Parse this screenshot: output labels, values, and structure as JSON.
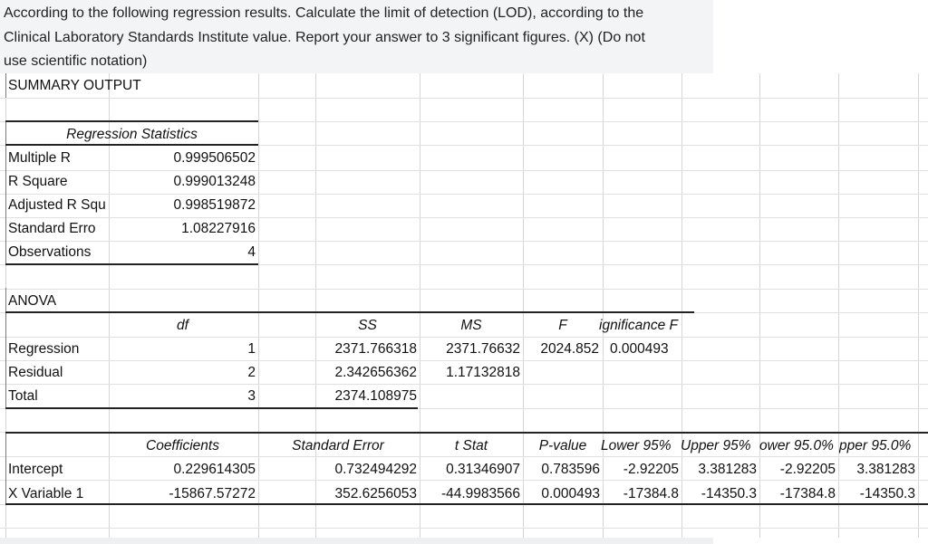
{
  "question": {
    "line1": "According to the following regression results.  Calculate the limit of detection (LOD), according to the",
    "line2": "Clinical Laboratory Standards Institute value.  Report your answer to 3 significant figures. (X) (Do not",
    "line3": "use scientific notation)"
  },
  "summary_title": "SUMMARY OUTPUT",
  "regression_statistics": {
    "header": "Regression Statistics",
    "rows": [
      {
        "label": "Multiple R",
        "value": "0.999506502"
      },
      {
        "label": "R Square",
        "value": "0.999013248"
      },
      {
        "label": "Adjusted R Squ",
        "value": "0.998519872"
      },
      {
        "label": "Standard Erro",
        "value": "1.08227916"
      },
      {
        "label": "Observations",
        "value": "4"
      }
    ]
  },
  "anova": {
    "title": "ANOVA",
    "headers": {
      "df": "df",
      "ss": "SS",
      "ms": "MS",
      "f": "F",
      "sig": "ignificance F"
    },
    "rows": [
      {
        "label": "Regression",
        "df": "1",
        "ss": "2371.766318",
        "ms": "2371.76632",
        "f": "2024.852",
        "sig": "0.000493"
      },
      {
        "label": "Residual",
        "df": "2",
        "ss": "2.342656362",
        "ms": "1.17132818",
        "f": "",
        "sig": ""
      },
      {
        "label": "Total",
        "df": "3",
        "ss": "2374.108975",
        "ms": "",
        "f": "",
        "sig": ""
      }
    ]
  },
  "coefficients": {
    "headers": {
      "coef": "Coefficients",
      "se": "Standard Error",
      "t": "t Stat",
      "p": "P-value",
      "lower95": "Lower 95%",
      "upper95": "Upper 95%",
      "lower950": "ower 95.0%",
      "upper950": "pper 95.0%"
    },
    "rows": [
      {
        "label": "Intercept",
        "coef": "0.229614305",
        "se": "0.732494292",
        "t": "0.31346907",
        "p": "0.783596",
        "lower95": "-2.92205",
        "upper95": "3.381283",
        "lower950": "-2.92205",
        "upper950": "3.381283"
      },
      {
        "label": "X Variable 1",
        "coef": "-15867.57272",
        "se": "352.6256053",
        "t": "-44.9983566",
        "p": "0.000493",
        "lower95": "-17384.8",
        "upper95": "-14350.3",
        "lower950": "-17384.8",
        "upper950": "-14350.3"
      }
    ]
  }
}
